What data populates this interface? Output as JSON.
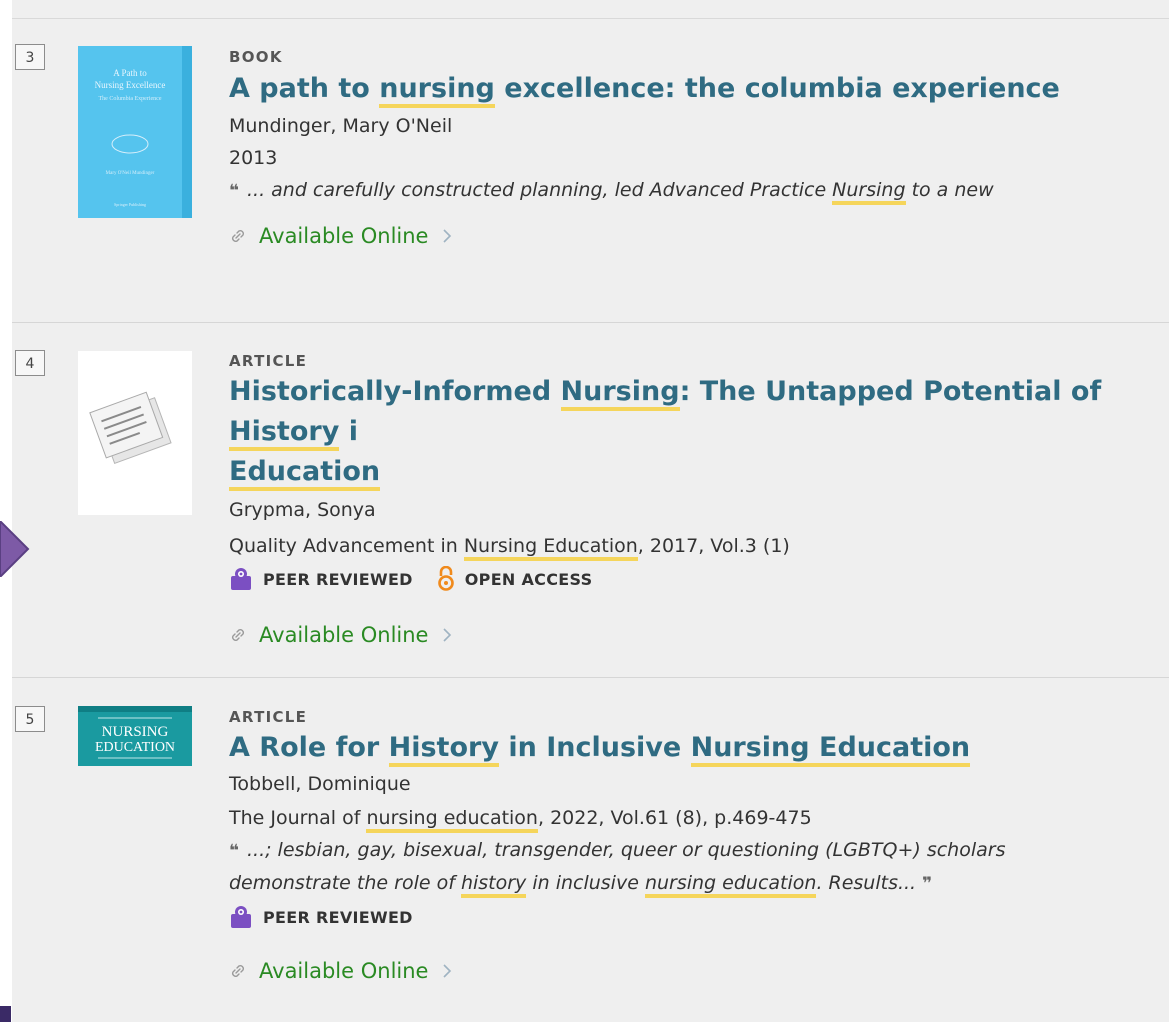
{
  "results": [
    {
      "number": "3",
      "type": "BOOK",
      "title": [
        {
          "t": "A path to "
        },
        {
          "t": "nursing",
          "hl": true
        },
        {
          "t": " excellence: the columbia experience"
        }
      ],
      "author": "Mundinger, Mary O'Neil",
      "date": "2013",
      "snippet": [
        {
          "t": "... and carefully constructed planning, led Advanced Practice "
        },
        {
          "t": "Nursing",
          "hl": true
        },
        {
          "t": " to a new"
        }
      ],
      "availability": "Available Online",
      "thumbnail": {
        "kind": "book-cover-icon",
        "color": "#55c4ee"
      }
    },
    {
      "number": "4",
      "type": "ARTICLE",
      "title": [
        {
          "t": "Historically-Informed "
        },
        {
          "t": "Nursing",
          "hl": true
        },
        {
          "t": ": The Untapped Potential of "
        },
        {
          "t": "History",
          "hl": true
        },
        {
          "t": " i"
        },
        {
          "br": true
        },
        {
          "t": "Education",
          "hl": true
        }
      ],
      "author": "Grypma, Sonya",
      "source": [
        {
          "t": "Quality Advancement in "
        },
        {
          "t": "Nursing Education",
          "hl": true
        },
        {
          "t": ", 2017, Vol.3 (1)"
        }
      ],
      "badges": [
        {
          "label": "PEER REVIEWED",
          "icon": "peer-reviewed-icon"
        },
        {
          "label": "OPEN ACCESS",
          "icon": "open-access-icon"
        }
      ],
      "availability": "Available Online",
      "thumbnail": {
        "kind": "document-icon",
        "color": "#ffffff"
      }
    },
    {
      "number": "5",
      "type": "ARTICLE",
      "title": [
        {
          "t": "A Role for "
        },
        {
          "t": "History",
          "hl": true
        },
        {
          "t": " in Inclusive "
        },
        {
          "t": "Nursing Education",
          "hl": true
        }
      ],
      "author": "Tobbell, Dominique",
      "source": [
        {
          "t": "The Journal of "
        },
        {
          "t": "nursing education",
          "hl": true
        },
        {
          "t": ", 2022, Vol.61 (8), p.469-475"
        }
      ],
      "snippet": [
        {
          "t": "...; lesbian, gay, bisexual, transgender, queer or questioning (LGBTQ+) scholars"
        },
        {
          "br": true
        },
        {
          "t": "demonstrate the role of "
        },
        {
          "t": "history",
          "hl": true
        },
        {
          "t": " in inclusive "
        },
        {
          "t": "nursing education",
          "hl": true
        },
        {
          "t": ". Results..."
        }
      ],
      "badges": [
        {
          "label": "PEER REVIEWED",
          "icon": "peer-reviewed-icon"
        }
      ],
      "availability": "Available Online",
      "thumbnail": {
        "kind": "journal-cover-icon",
        "color": "#1a9aa0"
      }
    }
  ],
  "colors": {
    "title": "#2f6b82",
    "highlight": "#f5d55b",
    "available": "#2a8a23",
    "peer_reviewed": "#7b4fc2",
    "open_access": "#f08a1c",
    "side_arrow": "#7d5aa6"
  },
  "side_arrow_icon": "chevron-right-icon"
}
